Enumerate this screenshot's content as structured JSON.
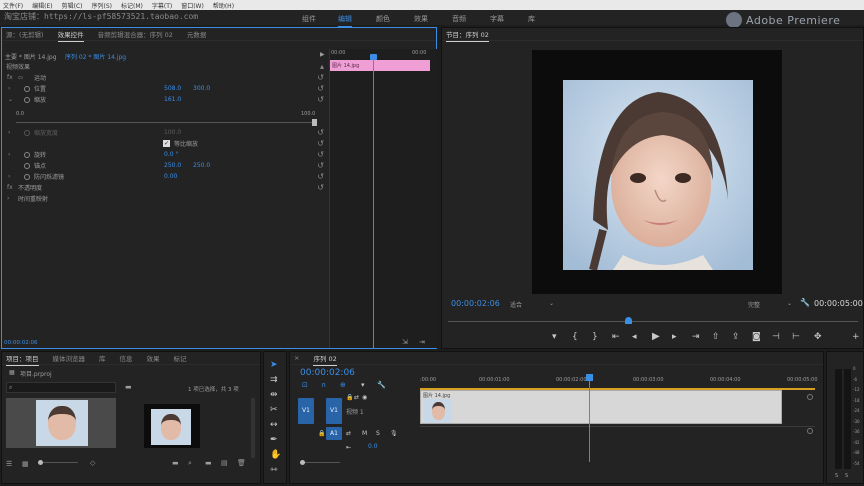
{
  "menubar": [
    "文件(F)",
    "编辑(E)",
    "剪辑(C)",
    "序列(S)",
    "标记(M)",
    "字幕(T)",
    "窗口(W)",
    "帮助(H)"
  ],
  "watermark": "淘宝店铺：https://ls-pf58573521.taobao.com",
  "workspaces": [
    {
      "label": "组件",
      "active": false
    },
    {
      "label": "编辑",
      "active": true
    },
    {
      "label": "颜色",
      "active": false
    },
    {
      "label": "效果",
      "active": false
    },
    {
      "label": "音频",
      "active": false
    },
    {
      "label": "字幕",
      "active": false
    },
    {
      "label": "库",
      "active": false
    }
  ],
  "brand": "Adobe Premiere",
  "ec": {
    "tabs": [
      "源：(无剪辑)",
      "效果控件",
      "音频剪辑混合器：序列 02",
      "元数据"
    ],
    "breadcrumb_master": "主要 * 图片 14.jpg",
    "breadcrumb_seq": "序列 02 * 图片 14.jpg",
    "ruler_start": "00:00",
    "ruler_end": "00:00",
    "clip_label": "图片 14.jpg",
    "section": "视频效果",
    "motion": "运动",
    "position_label": "位置",
    "position_x": "508.0",
    "position_y": "300.0",
    "scale_label": "缩放",
    "scale_value": "161.0",
    "slider_min": "0.0",
    "slider_max": "100.0",
    "scale_width_label": "缩放宽度",
    "scale_width_value": "100.0",
    "uniform_scale": "等比缩放",
    "rotation_label": "旋转",
    "rotation_value": "0.0 °",
    "anchor_label": "锚点",
    "anchor_x": "250.0",
    "anchor_y": "250.0",
    "antiflicker_label": "防闪烁滤镜",
    "antiflicker_value": "0.00",
    "opacity": "不透明度",
    "time_remap": "时间重映射",
    "timecode": "00:00:02:06"
  },
  "program": {
    "title": "节目：序列 02",
    "timecode": "00:00:02:06",
    "fit": "适合",
    "quality": "完整",
    "duration": "00:00:05:00",
    "playhead_fraction": 0.44
  },
  "project": {
    "tabs": [
      "项目：项目",
      "媒体浏览器",
      "库",
      "信息",
      "效果",
      "标记"
    ],
    "filename": "项目.prproj",
    "selection": "1 项已选择，共 3 项"
  },
  "timeline": {
    "title": "序列 02",
    "timecode": "00:00:02:06",
    "ruler": [
      ":00:00",
      "00:00:01:00",
      "00:00:02:00",
      "00:00:03:00",
      "00:00:04:00",
      "00:00:05:00"
    ],
    "v1": "V1",
    "a1": "A1",
    "video_label": "视频 1",
    "clip_name": "图片 14.jpg",
    "audio_level": "0.0",
    "playhead_fraction": 0.44
  },
  "meter": {
    "ticks": [
      "0",
      "-6",
      "-12",
      "-18",
      "-24",
      "-30",
      "-36",
      "-42",
      "-48",
      "-54"
    ],
    "s_labels": [
      "S",
      "S"
    ]
  },
  "colors": {
    "accent": "#3a8ee6",
    "clip_pink": "#ef9ed6",
    "panel_bg": "#232323"
  }
}
